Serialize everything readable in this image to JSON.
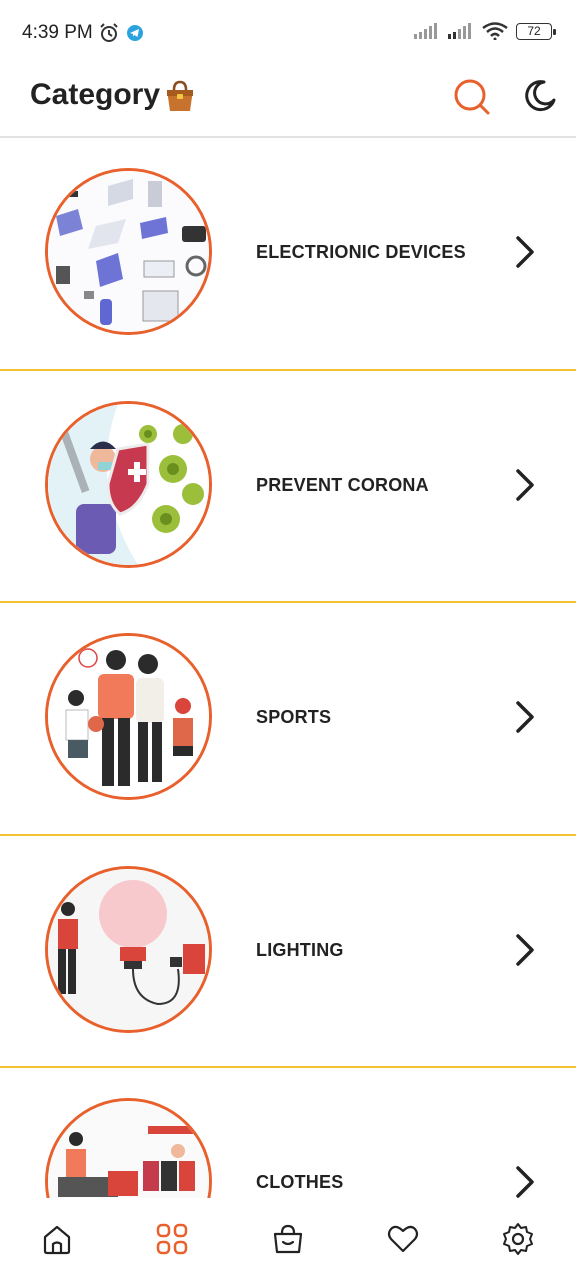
{
  "status_bar": {
    "time": "4:39 PM",
    "battery": "72",
    "icons": [
      "alarm-icon",
      "telegram-icon",
      "signal-icon",
      "signal-icon",
      "wifi-icon",
      "battery-icon"
    ]
  },
  "header": {
    "title": "Category",
    "title_emoji": "👜",
    "actions": [
      "search-icon",
      "moon-icon"
    ]
  },
  "categories": [
    {
      "label": "ELECTRIONIC DEVICES",
      "illustration": "electronic-devices-illustration"
    },
    {
      "label": "PREVENT CORONA",
      "illustration": "prevent-corona-illustration"
    },
    {
      "label": "SPORTS",
      "illustration": "sports-illustration"
    },
    {
      "label": "LIGHTING",
      "illustration": "lighting-illustration"
    },
    {
      "label": "CLOTHES",
      "illustration": "clothes-illustration"
    }
  ],
  "bottom_nav": {
    "items": [
      "home-icon",
      "category-icon",
      "bag-icon",
      "heart-icon",
      "settings-icon"
    ],
    "active": "category-icon"
  },
  "colors": {
    "accent": "#e8602c",
    "divider": "#f2c230",
    "text": "#222222"
  }
}
